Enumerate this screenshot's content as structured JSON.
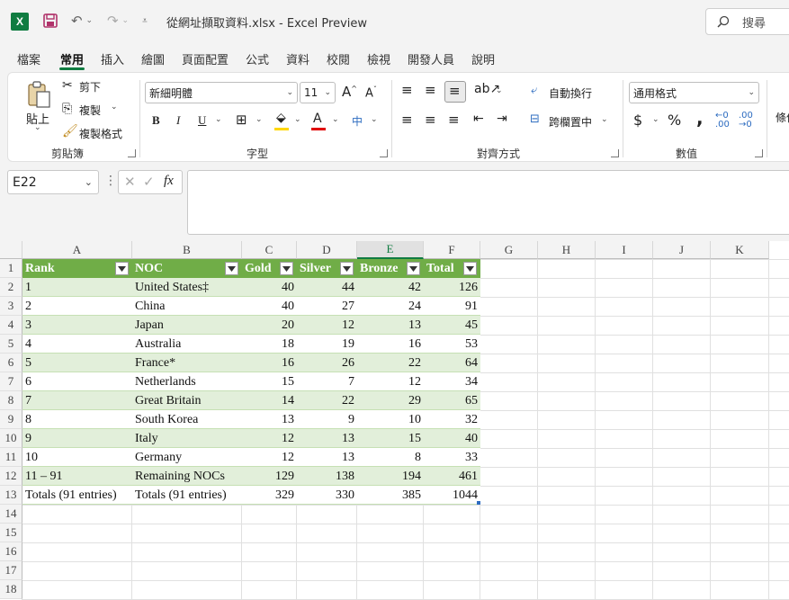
{
  "app": {
    "logo_letter": "X",
    "window_title": "從網址擷取資料.xlsx  -  Excel Preview",
    "search_label": "搜尋",
    "accent": "#107c41",
    "table_header_color": "#70ad47",
    "band_color": "#e2efda"
  },
  "menu": {
    "tabs": [
      "檔案",
      "常用",
      "插入",
      "繪圖",
      "頁面配置",
      "公式",
      "資料",
      "校閱",
      "檢視",
      "開發人員",
      "說明"
    ],
    "active": "常用"
  },
  "ribbon": {
    "clipboard": {
      "paste": "貼上",
      "cut": "剪下",
      "copy": "複製",
      "format_painter": "複製格式",
      "label": "剪貼簿"
    },
    "font": {
      "font_name": "新細明體",
      "font_size": "11",
      "bold": "B",
      "italic": "I",
      "underline": "U",
      "label": "字型"
    },
    "alignment": {
      "wrap_text": "自動換行",
      "merge_center": "跨欄置中",
      "label": "對齊方式"
    },
    "number": {
      "format": "通用格式",
      "currency": "$",
      "percent": "%",
      "comma": ",",
      "label": "數值"
    },
    "styles": {
      "conditional_partial": "條件"
    }
  },
  "formula_bar": {
    "name_box": "E22",
    "fx": "fx",
    "value": ""
  },
  "sheet": {
    "columns": [
      "A",
      "B",
      "C",
      "D",
      "E",
      "F",
      "G",
      "H",
      "I",
      "J",
      "K"
    ],
    "selected_column": "E",
    "row_numbers": [
      "1",
      "2",
      "3",
      "4",
      "5",
      "6",
      "7",
      "8",
      "9",
      "10",
      "11",
      "12",
      "13",
      "14",
      "15",
      "16",
      "17",
      "18"
    ],
    "table": {
      "headers": [
        "Rank",
        "NOC",
        "Gold",
        "Silver",
        "Bronze",
        "Total"
      ],
      "rows": [
        [
          "1",
          "United States‡",
          "40",
          "44",
          "42",
          "126"
        ],
        [
          "2",
          "China",
          "40",
          "27",
          "24",
          "91"
        ],
        [
          "3",
          "Japan",
          "20",
          "12",
          "13",
          "45"
        ],
        [
          "4",
          "Australia",
          "18",
          "19",
          "16",
          "53"
        ],
        [
          "5",
          "France*",
          "16",
          "26",
          "22",
          "64"
        ],
        [
          "6",
          "Netherlands",
          "15",
          "7",
          "12",
          "34"
        ],
        [
          "7",
          "Great Britain",
          "14",
          "22",
          "29",
          "65"
        ],
        [
          "8",
          "South Korea",
          "13",
          "9",
          "10",
          "32"
        ],
        [
          "9",
          "Italy",
          "12",
          "13",
          "15",
          "40"
        ],
        [
          "10",
          "Germany",
          "12",
          "13",
          "8",
          "33"
        ],
        [
          "11 – 91",
          "Remaining NOCs",
          "129",
          "138",
          "194",
          "461"
        ],
        [
          "Totals (91 entries)",
          "Totals (91 entries)",
          "329",
          "330",
          "385",
          "1044"
        ]
      ]
    }
  }
}
